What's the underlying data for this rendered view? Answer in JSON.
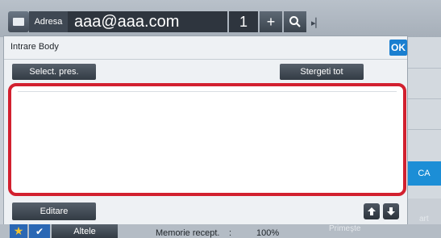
{
  "topbar": {
    "address_label": "Adresa",
    "address_value": "aaa@aaa.com",
    "recipient_count": "1",
    "plus_symbol": "+",
    "next_symbol": "▸▏"
  },
  "dialog": {
    "title": "Intrare Body",
    "ok_label": "OK",
    "select_preset_label": "Select. pres.",
    "clear_all_label": "Stergeti tot",
    "body_text": "",
    "edit_label": "Editare"
  },
  "side": {
    "ca_label": "CA",
    "start_label": "art"
  },
  "statusbar": {
    "other_label": "Altele",
    "memory_label": "Memorie recept.",
    "memory_colon": ":",
    "memory_value": "100%",
    "receive_label": "Primeşte"
  },
  "colors": {
    "accent_blue": "#1a7fd0",
    "highlight_red": "#d2202f"
  },
  "icons": [
    "address-book-icon",
    "search-icon",
    "next-icon",
    "arrow-up-icon",
    "arrow-down-icon",
    "star-icon",
    "check-icon"
  ]
}
